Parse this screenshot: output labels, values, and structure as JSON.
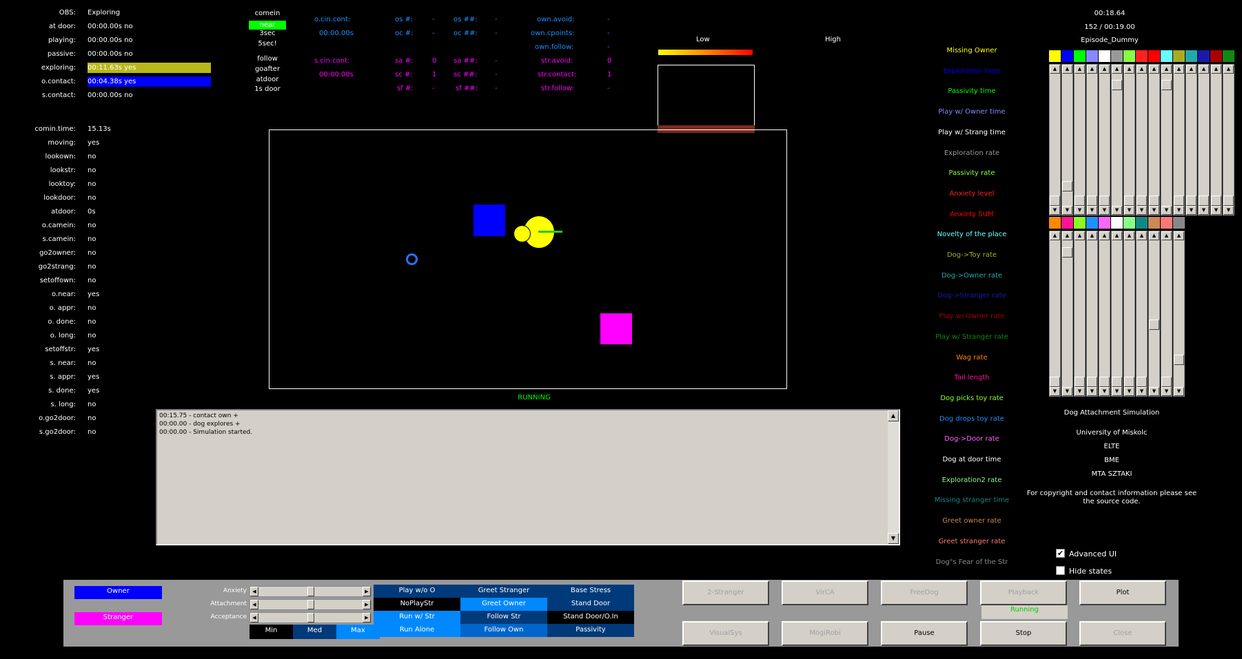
{
  "state_panel": {
    "rows": [
      {
        "label": "OBS:",
        "value": "Exploring"
      },
      {
        "label": "at door:",
        "value": "00:00.00s no"
      },
      {
        "label": "playing:",
        "value": "00:00.00s no"
      },
      {
        "label": "passive:",
        "value": "00:00.00s no"
      },
      {
        "label": "exploring:",
        "value": "00:11.63s yes",
        "bar": "#b8b81c"
      },
      {
        "label": "o.contact:",
        "value": "00:04.38s yes",
        "bar": "#0000ff"
      },
      {
        "label": "s.contact:",
        "value": "00:00.00s no"
      }
    ],
    "rows2": [
      {
        "label": "comin.time:",
        "value": "15.13s"
      },
      {
        "label": "moving:",
        "value": "yes"
      },
      {
        "label": "lookown:",
        "value": "no"
      },
      {
        "label": "lookstr:",
        "value": "no"
      },
      {
        "label": "looktoy:",
        "value": "no"
      },
      {
        "label": "lookdoor:",
        "value": "no"
      },
      {
        "label": "atdoor:",
        "value": "0s"
      },
      {
        "label": "o.camein:",
        "value": "no"
      },
      {
        "label": "s.camein:",
        "value": "no"
      },
      {
        "label": "go2owner:",
        "value": "no"
      },
      {
        "label": "go2strang:",
        "value": "no"
      },
      {
        "label": "setoffown:",
        "value": "no"
      },
      {
        "label": "o.near:",
        "value": "yes"
      },
      {
        "label": "o. appr:",
        "value": "no"
      },
      {
        "label": "o. done:",
        "value": "no"
      },
      {
        "label": "o. long:",
        "value": "no"
      },
      {
        "label": "setoffstr:",
        "value": "yes"
      },
      {
        "label": "s. near:",
        "value": "no"
      },
      {
        "label": "s. appr:",
        "value": "yes"
      },
      {
        "label": "s. done:",
        "value": "yes"
      },
      {
        "label": "s. long:",
        "value": "no"
      },
      {
        "label": "o.go2door:",
        "value": "no"
      },
      {
        "label": "s.go2door:",
        "value": "no"
      }
    ]
  },
  "comein": {
    "items": [
      "comein",
      "near",
      "3sec",
      "5sec!",
      "follow",
      "goafter",
      "atdoor",
      "1s door"
    ],
    "active_index": 1,
    "active_color": "#00ff00"
  },
  "counters": {
    "owner": {
      "color": "#1e90ff",
      "r1": [
        "o.cin.cont:",
        "os #:",
        "-",
        "os ##:",
        "-",
        "own.avoid:",
        "-"
      ],
      "r2": [
        "00:00.00s",
        "oc #:",
        "-",
        "oc ##:",
        "-",
        "own.cpoints:",
        "-"
      ],
      "r3": [
        "own.follow:",
        "-"
      ]
    },
    "stranger": {
      "color": "#ff00ff",
      "r1": [
        "s.cin.cont:",
        "sa #:",
        "0",
        "sa ##:",
        "-",
        "str.avoid:",
        "0"
      ],
      "r2": [
        "00:00.00s",
        "sc #:",
        "1",
        "sc ##:",
        "-",
        "str.contact:",
        "1"
      ],
      "r3": [
        "sf #:",
        "-",
        "sf ##:",
        "-",
        "str.follow:",
        "-"
      ]
    }
  },
  "scale": {
    "low": "Low",
    "high": "High"
  },
  "sim": {
    "status": "RUNNING",
    "status_color": "#00ff00"
  },
  "log": {
    "lines": [
      "00:15.75 - contact own +",
      "00:00.00 - dog explores +",
      "00:00.00 - Simulation started."
    ]
  },
  "metrics": [
    {
      "label": "Missing Owner",
      "color": "#ffff00"
    },
    {
      "label": "Exploration time",
      "color": "#0000ff"
    },
    {
      "label": "Passivity time",
      "color": "#00ff00"
    },
    {
      "label": "Play w/ Owner time",
      "color": "#8888ff"
    },
    {
      "label": "Play w/ Strang time",
      "color": "#ffffff"
    },
    {
      "label": "Exploration rate",
      "color": "#999999"
    },
    {
      "label": "Passivity rate",
      "color": "#88ff44"
    },
    {
      "label": "Anxiety level",
      "color": "#ff2222"
    },
    {
      "label": "Anxiety SUM",
      "color": "#ff0000"
    },
    {
      "label": "Novelty of the place",
      "color": "#66ffff"
    },
    {
      "label": "Dog->Toy rate",
      "color": "#aaaa22"
    },
    {
      "label": "Dog->Owner rate",
      "color": "#22aaaa"
    },
    {
      "label": "Dog->Stranger rate",
      "color": "#1a1aaa"
    },
    {
      "label": "Play w/ Owner rate",
      "color": "#aa0000"
    },
    {
      "label": "Play w/ Stranger rate",
      "color": "#118811"
    },
    {
      "label": "Wag rate",
      "color": "#ff8800"
    },
    {
      "label": "Tail length",
      "color": "#ff1493"
    },
    {
      "label": "Dog picks toy rate",
      "color": "#88ff22"
    },
    {
      "label": "Dog drops toy rate",
      "color": "#1e90ff"
    },
    {
      "label": "Dog->Door rate",
      "color": "#ff66ff"
    },
    {
      "label": "Dog at door time",
      "color": "#ffffff"
    },
    {
      "label": "Exploration2 rate",
      "color": "#88ff88"
    },
    {
      "label": "Missing stranger time",
      "color": "#118888"
    },
    {
      "label": "Greet owner rate",
      "color": "#cc8855"
    },
    {
      "label": "Greet stranger rate",
      "color": "#ff7777"
    },
    {
      "label": "Dog\"s Fear of the Str",
      "color": "#888888"
    }
  ],
  "header_right": {
    "time": "00:18.64",
    "progress": "152 / 00:19.00",
    "episode": "Episode_Dummy"
  },
  "slider_bank1": {
    "colors": [
      "#ffff00",
      "#0000ff",
      "#00ff00",
      "#8888ff",
      "#ffffff",
      "#999999",
      "#88ff44",
      "#ff2222",
      "#ff0000",
      "#66ffff",
      "#aaaa22",
      "#22aaaa",
      "#1a1aaa",
      "#aa0000",
      "#118811"
    ],
    "levels": [
      0.0,
      0.12,
      0.0,
      0.0,
      0.0,
      0.95,
      0.0,
      0.0,
      0.0,
      0.95,
      0.0,
      0.0,
      0.0,
      0.0,
      0.0
    ]
  },
  "slider_bank2": {
    "colors": [
      "#ff8800",
      "#ff1493",
      "#88ff22",
      "#1e90ff",
      "#ff66ff",
      "#ffffff",
      "#88ff88",
      "#118888",
      "#cc8855",
      "#ff7777",
      "#888888"
    ],
    "levels": [
      0.0,
      0.95,
      0.0,
      0.0,
      0.0,
      0.0,
      0.0,
      0.0,
      0.42,
      0.0,
      0.16
    ]
  },
  "about": {
    "title": "Dog Attachment Simulation",
    "lines": [
      "University of Miskolc",
      "ELTE",
      "BME",
      "MTA SZTAKI"
    ],
    "copyright": "For copyright and contact information please see the source code."
  },
  "options": {
    "advanced_ui": {
      "label": "Advanced UI",
      "checked": true
    },
    "hide_states": {
      "label": "Hide states",
      "checked": false
    }
  },
  "bottom": {
    "owner_label": "Owner",
    "stranger_label": "Stranger",
    "slider_labels": [
      "Anxiety",
      "Attachment",
      "Acceptance"
    ],
    "slider_levels": [
      0.5,
      0.5,
      0.5
    ],
    "level_buttons": [
      "Min",
      "Med",
      "Max"
    ],
    "grid": [
      [
        "Play w/o O",
        "Greet Stranger",
        "Base Stress"
      ],
      [
        "NoPlayStr",
        "Greet Owner",
        "Stand Door"
      ],
      [
        "Run w/ Str",
        "Follow Str",
        "Stand Door/O.In"
      ],
      [
        "Run Alone",
        "Follow Own",
        "Passivity"
      ]
    ],
    "buttons_row1": [
      {
        "label": "2-Stranger",
        "enabled": false
      },
      {
        "label": "VirCA",
        "enabled": false
      },
      {
        "label": "FreeDog",
        "enabled": false
      },
      {
        "label": "Playback",
        "enabled": false
      },
      {
        "label": "Plot",
        "enabled": true
      }
    ],
    "running_label": "Running",
    "buttons_row2": [
      {
        "label": "VisualSys",
        "enabled": false
      },
      {
        "label": "MogiRobi",
        "enabled": false
      },
      {
        "label": "Pause",
        "enabled": true
      },
      {
        "label": "Stop",
        "enabled": true
      },
      {
        "label": "Close",
        "enabled": false
      }
    ]
  }
}
